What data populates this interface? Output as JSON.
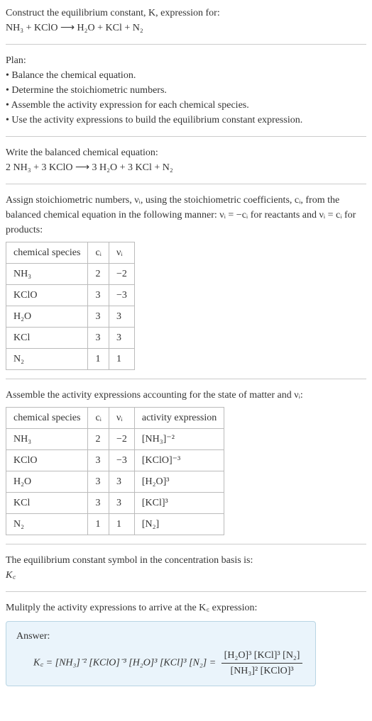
{
  "header": {
    "line1": "Construct the equilibrium constant, K, expression for:",
    "line2": "NH₃ + KClO ⟶ H₂O + KCl + N₂"
  },
  "plan": {
    "title": "Plan:",
    "b1": "• Balance the chemical equation.",
    "b2": "• Determine the stoichiometric numbers.",
    "b3": "• Assemble the activity expression for each chemical species.",
    "b4": "• Use the activity expressions to build the equilibrium constant expression."
  },
  "balanced": {
    "title": "Write the balanced chemical equation:",
    "eq": "2 NH₃ + 3 KClO ⟶ 3 H₂O + 3 KCl + N₂"
  },
  "stoich": {
    "intro1": "Assign stoichiometric numbers, νᵢ, using the stoichiometric coefficients, cᵢ, from the balanced chemical equation in the following manner: νᵢ = −cᵢ for reactants and νᵢ = cᵢ for products:",
    "headers": {
      "h1": "chemical species",
      "h2": "cᵢ",
      "h3": "νᵢ"
    },
    "rows": [
      {
        "sp": "NH₃",
        "c": "2",
        "v": "−2"
      },
      {
        "sp": "KClO",
        "c": "3",
        "v": "−3"
      },
      {
        "sp": "H₂O",
        "c": "3",
        "v": "3"
      },
      {
        "sp": "KCl",
        "c": "3",
        "v": "3"
      },
      {
        "sp": "N₂",
        "c": "1",
        "v": "1"
      }
    ]
  },
  "activity": {
    "intro": "Assemble the activity expressions accounting for the state of matter and νᵢ:",
    "headers": {
      "h1": "chemical species",
      "h2": "cᵢ",
      "h3": "νᵢ",
      "h4": "activity expression"
    },
    "rows": [
      {
        "sp": "NH₃",
        "c": "2",
        "v": "−2",
        "a": "[NH₃]⁻²"
      },
      {
        "sp": "KClO",
        "c": "3",
        "v": "−3",
        "a": "[KClO]⁻³"
      },
      {
        "sp": "H₂O",
        "c": "3",
        "v": "3",
        "a": "[H₂O]³"
      },
      {
        "sp": "KCl",
        "c": "3",
        "v": "3",
        "a": "[KCl]³"
      },
      {
        "sp": "N₂",
        "c": "1",
        "v": "1",
        "a": "[N₂]"
      }
    ]
  },
  "symbol": {
    "line1": "The equilibrium constant symbol in the concentration basis is:",
    "line2": "K꜀"
  },
  "multiply": {
    "intro": "Mulitply the activity expressions to arrive at the K꜀ expression:"
  },
  "answer": {
    "label": "Answer:",
    "lhs": "K꜀ = [NH₃]⁻² [KClO]⁻³ [H₂O]³ [KCl]³ [N₂] =",
    "num": "[H₂O]³ [KCl]³ [N₂]",
    "den": "[NH₃]² [KClO]³"
  },
  "chart_data": {
    "type": "table",
    "tables": [
      {
        "title": "Stoichiometric numbers",
        "columns": [
          "chemical species",
          "cᵢ",
          "νᵢ"
        ],
        "rows": [
          [
            "NH₃",
            2,
            -2
          ],
          [
            "KClO",
            3,
            -3
          ],
          [
            "H₂O",
            3,
            3
          ],
          [
            "KCl",
            3,
            3
          ],
          [
            "N₂",
            1,
            1
          ]
        ]
      },
      {
        "title": "Activity expressions",
        "columns": [
          "chemical species",
          "cᵢ",
          "νᵢ",
          "activity expression"
        ],
        "rows": [
          [
            "NH₃",
            2,
            -2,
            "[NH₃]⁻²"
          ],
          [
            "KClO",
            3,
            -3,
            "[KClO]⁻³"
          ],
          [
            "H₂O",
            3,
            3,
            "[H₂O]³"
          ],
          [
            "KCl",
            3,
            3,
            "[KCl]³"
          ],
          [
            "N₂",
            1,
            1,
            "[N₂]"
          ]
        ]
      }
    ]
  }
}
